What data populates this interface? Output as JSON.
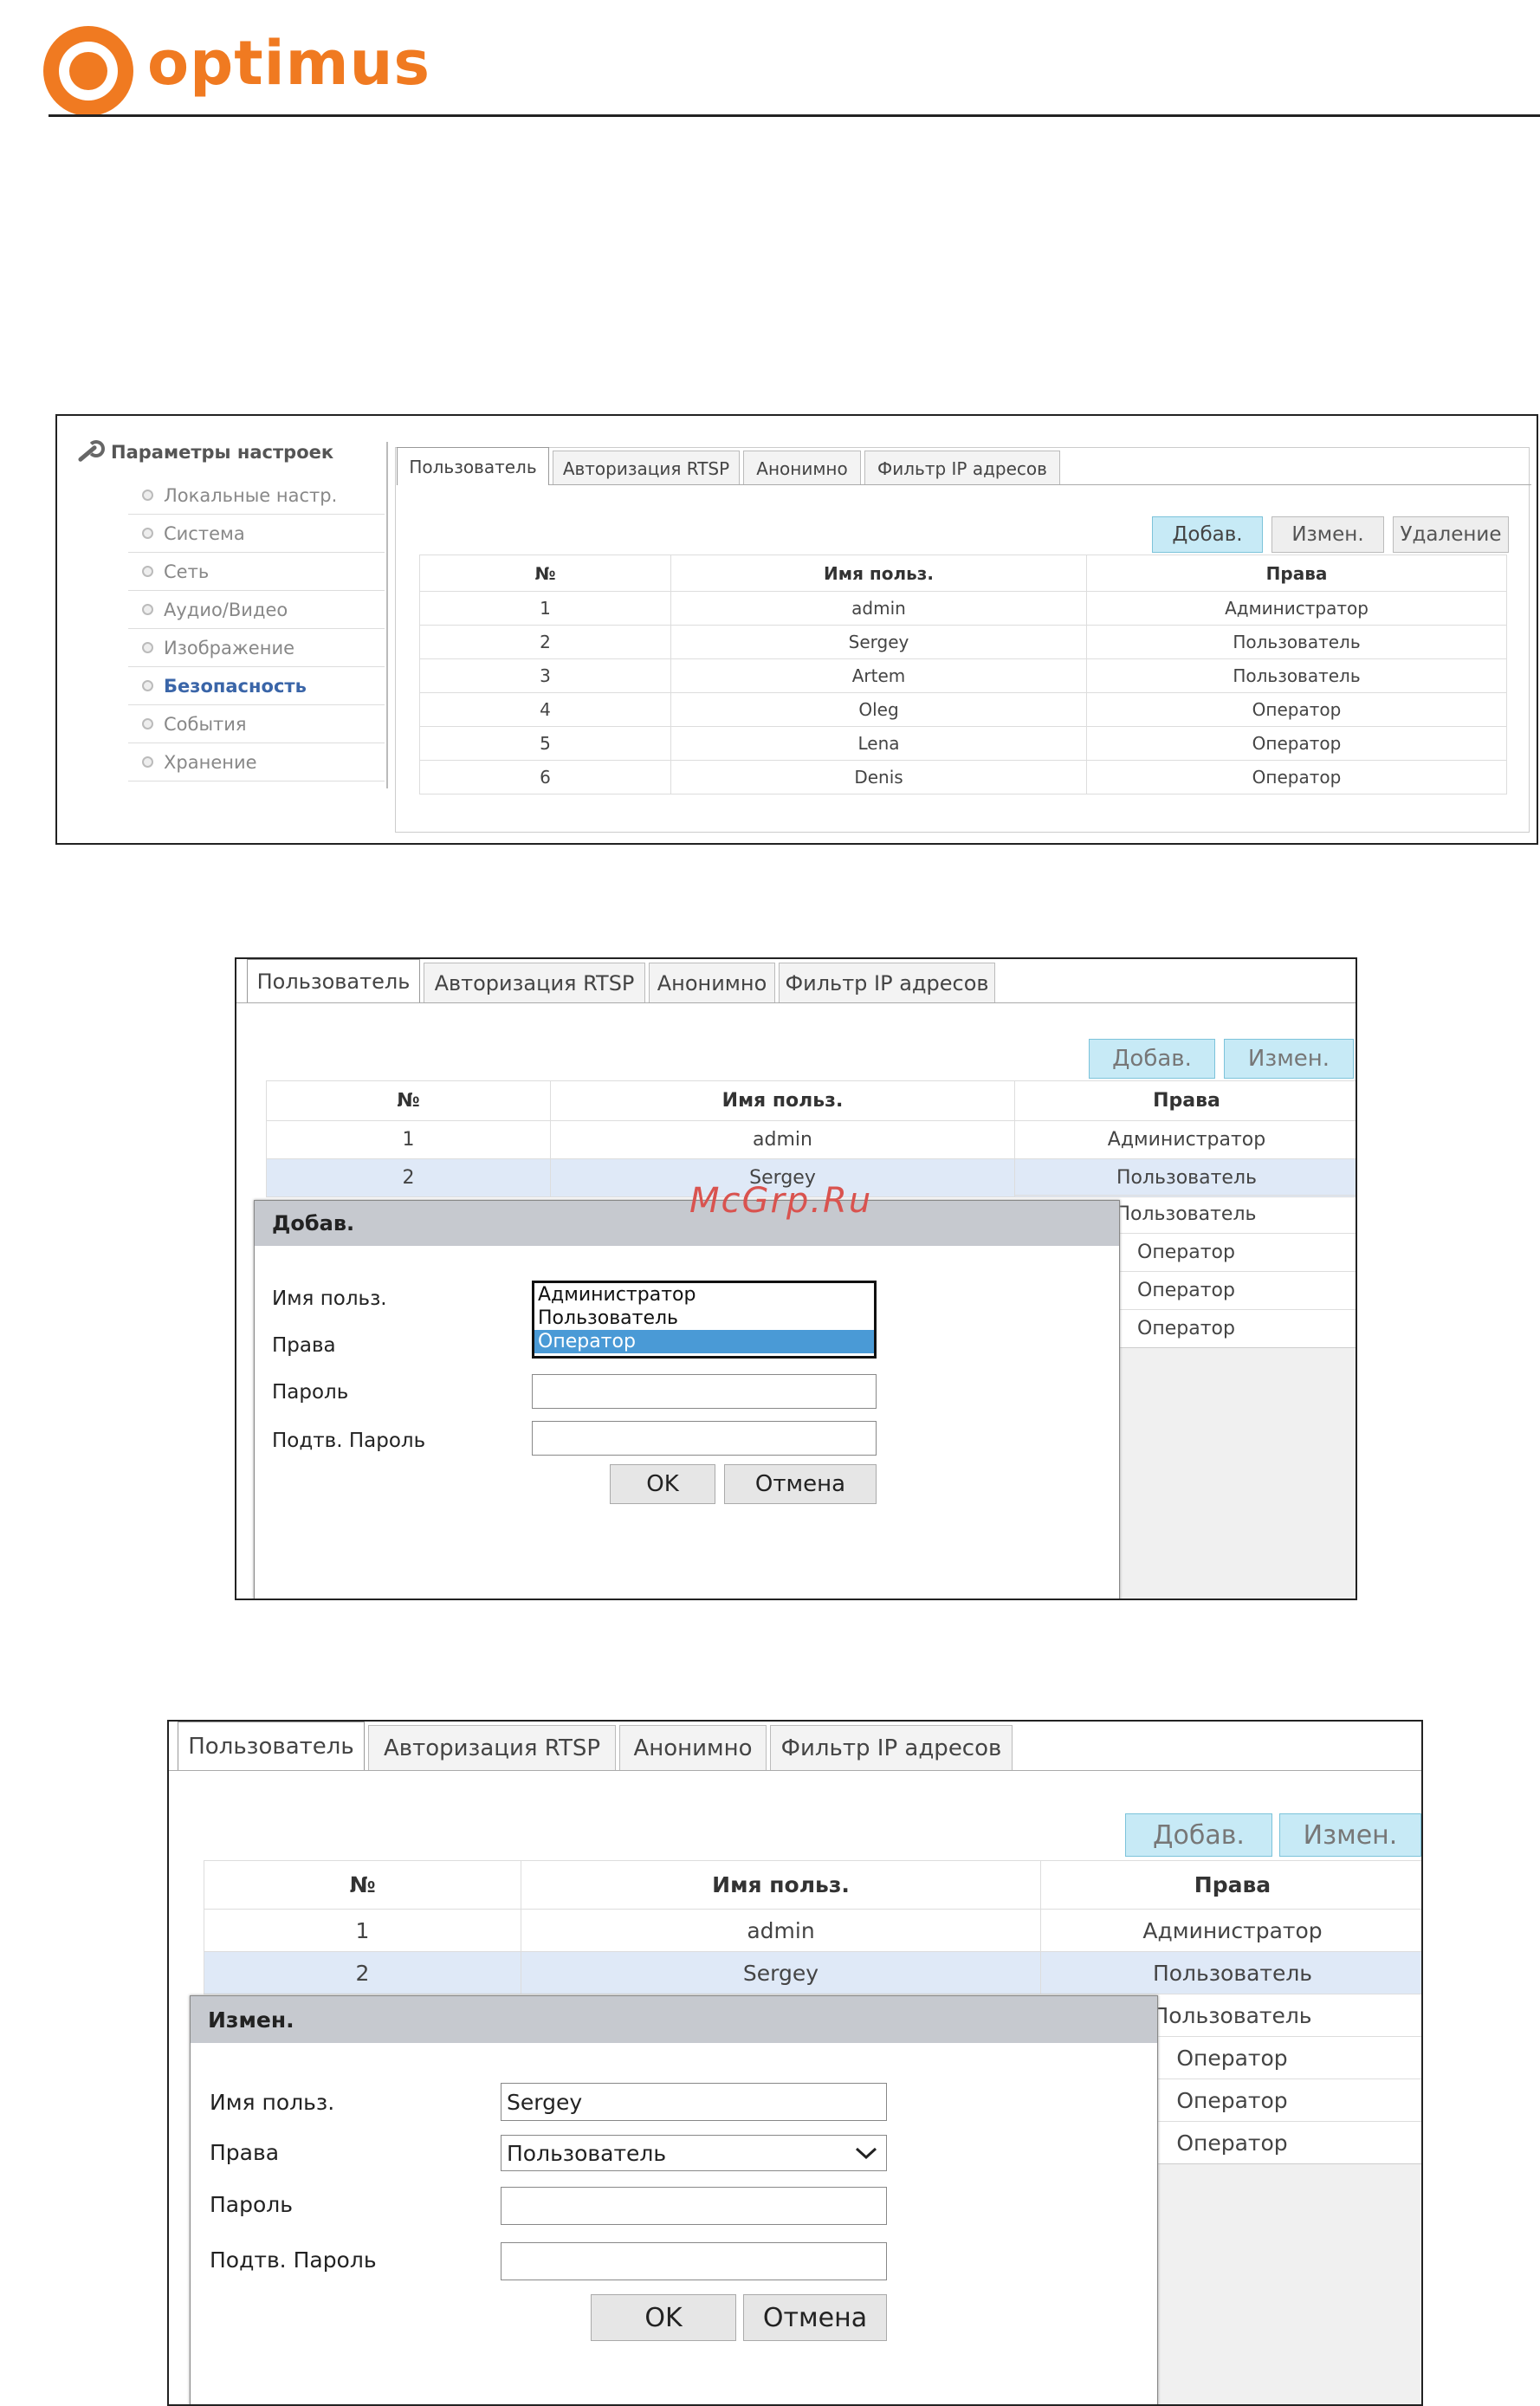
{
  "brand": {
    "name": "optimus"
  },
  "panel1": {
    "sidebar": {
      "title": "Параметры настроек",
      "items": [
        {
          "label": "Локальные настр.",
          "active": false
        },
        {
          "label": "Система",
          "active": false
        },
        {
          "label": "Сеть",
          "active": false
        },
        {
          "label": "Аудио/Видео",
          "active": false
        },
        {
          "label": "Изображение",
          "active": false
        },
        {
          "label": "Безопасность",
          "active": true
        },
        {
          "label": "События",
          "active": false
        },
        {
          "label": "Хранение",
          "active": false
        }
      ]
    },
    "tabs": [
      "Пользователь",
      "Авторизация RTSP",
      "Анонимно",
      "Фильтр IP адресов"
    ],
    "buttons": {
      "add": "Добав.",
      "edit": "Измен.",
      "delete": "Удаление"
    },
    "table": {
      "headers": [
        "№",
        "Имя польз.",
        "Права"
      ],
      "rows": [
        [
          "1",
          "admin",
          "Администратор"
        ],
        [
          "2",
          "Sergey",
          "Пользователь"
        ],
        [
          "3",
          "Artem",
          "Пользователь"
        ],
        [
          "4",
          "Oleg",
          "Оператор"
        ],
        [
          "5",
          "Lena",
          "Оператор"
        ],
        [
          "6",
          "Denis",
          "Оператор"
        ]
      ]
    }
  },
  "panel2": {
    "tabs": [
      "Пользователь",
      "Авторизация RTSP",
      "Анонимно",
      "Фильтр IP адресов"
    ],
    "buttons": {
      "add": "Добав.",
      "edit": "Измен."
    },
    "table": {
      "headers": [
        "№",
        "Имя польз.",
        "Права"
      ],
      "rows": [
        [
          "1",
          "admin",
          "Администратор"
        ],
        [
          "2",
          "Sergey",
          "Пользователь"
        ]
      ],
      "rights_rest": [
        "Пользователь",
        "Оператор",
        "Оператор",
        "Оператор"
      ]
    },
    "dialog": {
      "title": "Добав.",
      "labels": {
        "username": "Имя польз.",
        "rights": "Права",
        "password": "Пароль",
        "confirm": "Подтв. Пароль"
      },
      "options": [
        "Администратор",
        "Пользователь",
        "Оператор"
      ],
      "selected_option": "Оператор",
      "ok": "OK",
      "cancel": "Отмена"
    }
  },
  "panel3": {
    "tabs": [
      "Пользователь",
      "Авторизация RTSP",
      "Анонимно",
      "Фильтр IP адресов"
    ],
    "buttons": {
      "add": "Добав.",
      "edit": "Измен."
    },
    "table": {
      "headers": [
        "№",
        "Имя польз.",
        "Права"
      ],
      "rows": [
        [
          "1",
          "admin",
          "Администратор"
        ],
        [
          "2",
          "Sergey",
          "Пользователь"
        ]
      ],
      "rights_rest": [
        "Пользователь",
        "Оператор",
        "Оператор",
        "Оператор"
      ]
    },
    "dialog": {
      "title": "Измен.",
      "labels": {
        "username": "Имя польз.",
        "rights": "Права",
        "password": "Пароль",
        "confirm": "Подтв. Пароль"
      },
      "username_value": "Sergey",
      "rights_value": "Пользователь",
      "ok": "OK",
      "cancel": "Отмена"
    }
  },
  "watermark": "McGrp.Ru",
  "colors": {
    "brand": "#f07a21",
    "primary_button": "#c7eaf6",
    "selected_row": "#dfe9f7",
    "dialog_title": "#c6c9cf",
    "list_highlight": "#4a9ad6"
  }
}
